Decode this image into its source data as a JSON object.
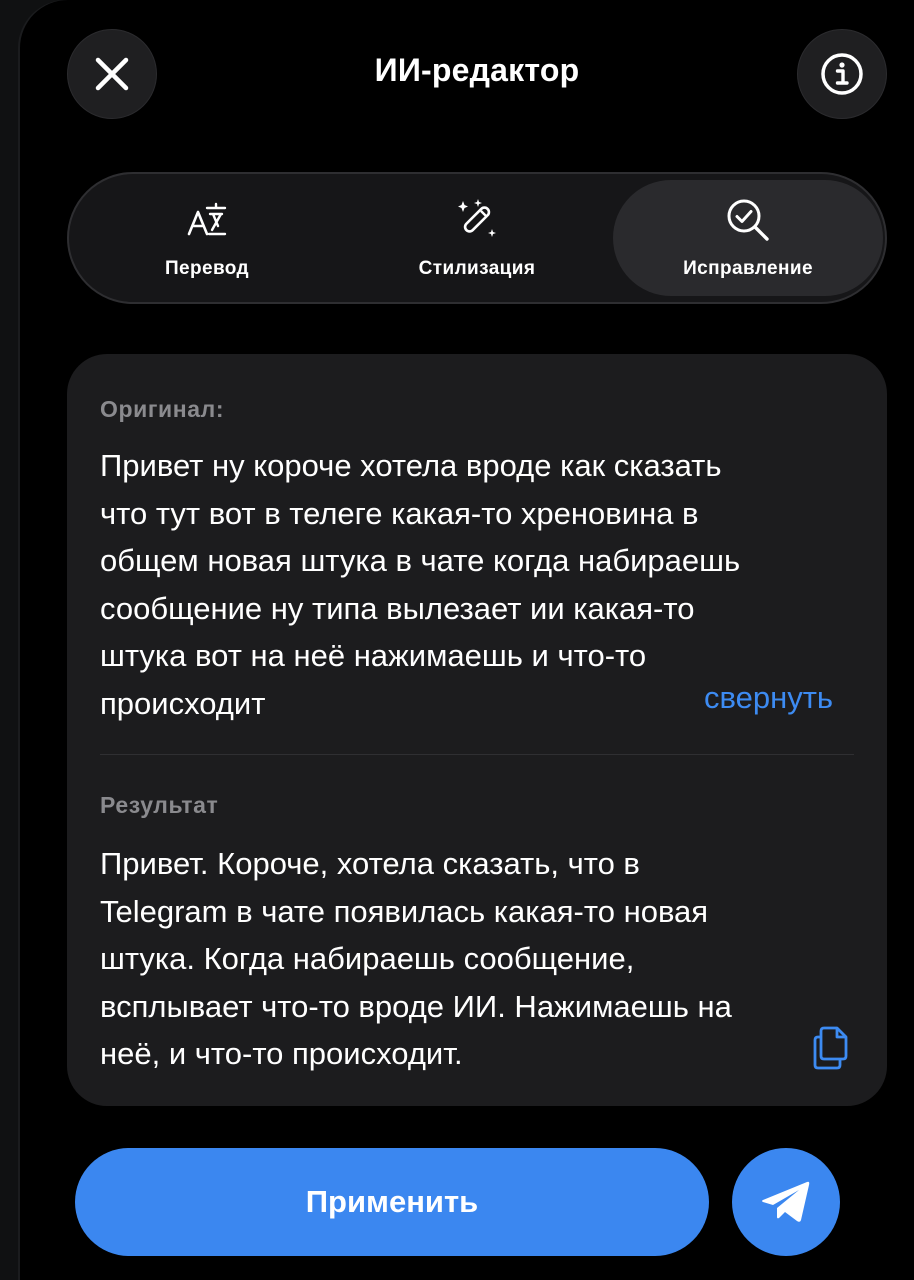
{
  "header": {
    "title": "ИИ-редактор",
    "close_icon": "close-icon",
    "info_icon": "info-icon"
  },
  "tabs": [
    {
      "label": "Перевод",
      "icon": "translate-icon",
      "selected": false
    },
    {
      "label": "Стилизация",
      "icon": "magic-wand-icon",
      "selected": false
    },
    {
      "label": "Исправление",
      "icon": "check-search-icon",
      "selected": true
    }
  ],
  "card": {
    "original_label": "Оригинал:",
    "original_text": "Привет ну короче хотела вроде как сказать\nчто тут вот в телеге какая-то хреновина в\nобщем новая штука в чате когда набираешь\nсообщение ну типа вылезает ии какая-то\nштука вот  на неё нажимаешь и что-то\nпроисходит",
    "collapse_label": "свернуть",
    "result_label": "Результат",
    "result_text": "Привет. Короче, хотела сказать, что в\nTelegram в чате появилась какая-то новая\nштука. Когда набираешь сообщение,\nвсплывает что-то вроде ИИ. Нажимаешь на\nнеё, и что-то происходит.",
    "copy_icon": "copy-icon"
  },
  "actions": {
    "apply_label": "Применить",
    "send_icon": "send-icon"
  },
  "colors": {
    "accent": "#3b87f0",
    "link": "#3d8bf2",
    "card_bg": "#1c1c1e",
    "muted_label": "#8a8a8e"
  }
}
